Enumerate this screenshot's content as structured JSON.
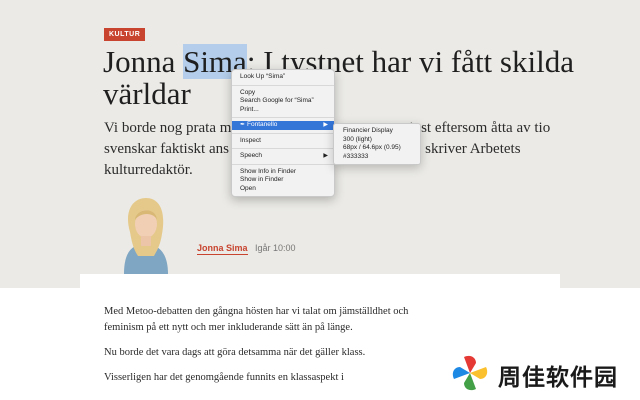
{
  "article": {
    "kicker": "KULTUR",
    "headline_before": "Jonna ",
    "headline_selected": "Sima",
    "headline_after": ": I tystnet har vi fått skilda världar",
    "lede_line1": "Vi borde nog prata m",
    "lede_line1_end": "inst eftersom åtta av tio",
    "lede_line2": "svenskar faktiskt ans",
    "lede_line2_end": "e, skriver Arbetets",
    "lede_line3": "kulturredaktör.",
    "author_name": "Jonna Sima",
    "published": "Igår 10:00",
    "paragraphs": [
      "Med Metoo-debatten den gångna hösten har vi talat om jämställdhet och feminism på ett nytt och mer inkluderande sätt än på länge.",
      "Nu borde det vara dags att göra detsamma när det gäller klass.",
      "Visserligen har det genomgående funnits en klassaspekt i"
    ]
  },
  "context_menu": {
    "items": [
      {
        "label": "Look Up “Sima”"
      },
      {
        "label": "Copy"
      },
      {
        "label": "Search Google for “Sima”"
      },
      {
        "label": "Print..."
      },
      {
        "label": "Fontanello",
        "icon": "fontanello-icon"
      },
      {
        "label": "Inspect"
      },
      {
        "label": "Speech"
      },
      {
        "label": "Show Info in Finder"
      },
      {
        "label": "Show in Finder"
      },
      {
        "label": "Open"
      }
    ],
    "submenu_arrow": "▶"
  },
  "font_submenu": {
    "family": "Financier Display",
    "weight": "300 (light)",
    "size": "68px / 64.6px (0.95)",
    "color": "#333333"
  },
  "watermark": {
    "text": "周佳软件园"
  },
  "colors": {
    "accent": "#c8442f",
    "selection": "#b3cdea",
    "menu_highlight": "#3475d8",
    "header_bg": "#ebeae6"
  }
}
